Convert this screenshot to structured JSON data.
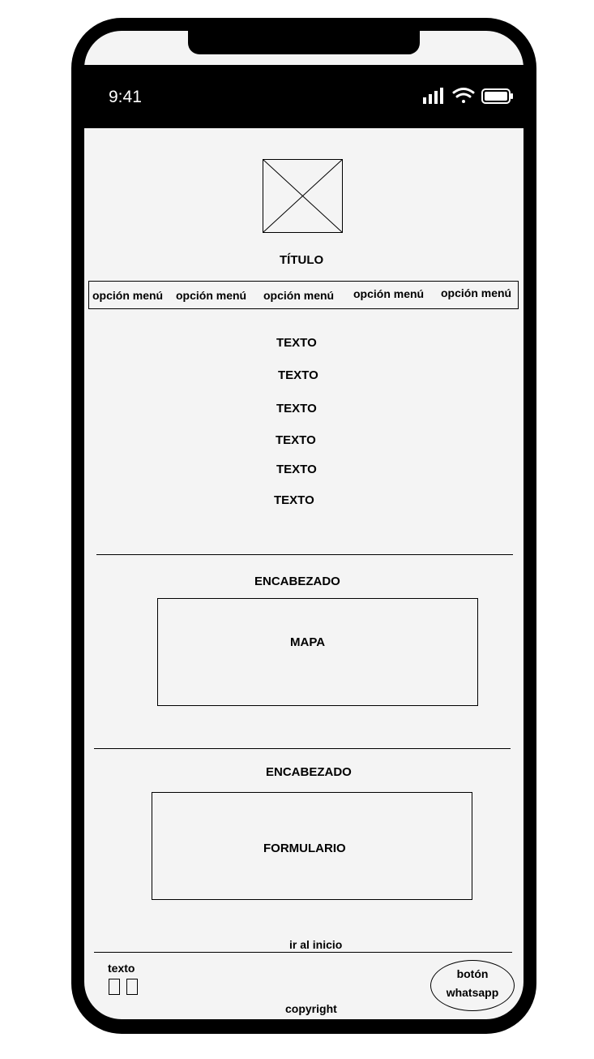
{
  "status_bar": {
    "time": "9:41"
  },
  "header": {
    "title": "TÍTULO"
  },
  "menu": {
    "items": [
      "opción menú",
      "opción menú",
      "opción menú",
      "opción menú",
      "opción menú"
    ]
  },
  "content": {
    "texts": [
      "TEXTO",
      "TEXTO",
      "TEXTO",
      "TEXTO",
      "TEXTO",
      "TEXTO"
    ]
  },
  "map_section": {
    "heading": "ENCABEZADO",
    "placeholder": "MAPA"
  },
  "form_section": {
    "heading": "ENCABEZADO",
    "placeholder": "FORMULARIO"
  },
  "footer": {
    "back_to_top": "ir al inicio",
    "text": "texto",
    "whatsapp_line1": "botón",
    "whatsapp_line2": "whatsapp",
    "copyright": "copyright"
  },
  "icons": [
    "signal-icon",
    "wifi-icon",
    "battery-icon",
    "image-placeholder-icon",
    "social-icon"
  ]
}
